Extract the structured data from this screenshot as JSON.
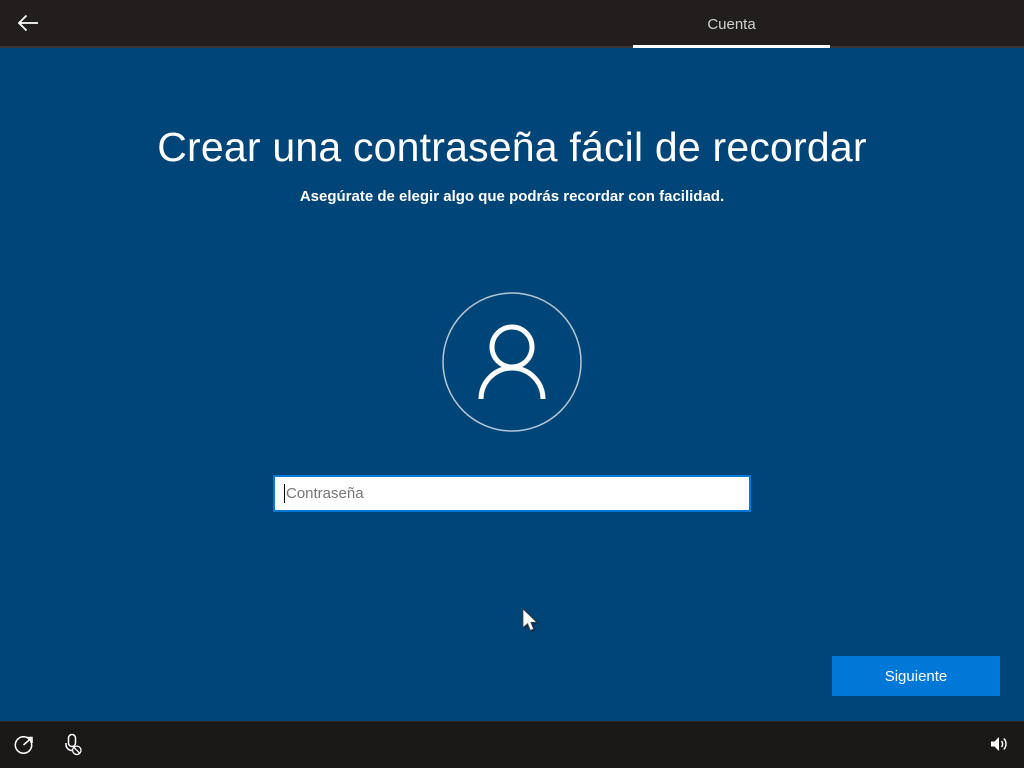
{
  "header": {
    "back_button": {
      "icon": "back-arrow-icon"
    },
    "active_tab": {
      "label": "Cuenta"
    }
  },
  "main": {
    "title": "Crear una contraseña fácil de recordar",
    "subtitle": "Asegúrate de elegir algo que podrás recordar con facilidad.",
    "avatar": {
      "icon": "user-avatar-icon"
    },
    "password_input": {
      "value": "",
      "placeholder": "Contraseña"
    },
    "next_button": {
      "label": "Siguiente"
    }
  },
  "footer": {
    "ease_of_access_button": {
      "icon": "ease-of-access-icon"
    },
    "microphone_button": {
      "icon": "microphone-muted-icon"
    },
    "volume_button": {
      "icon": "volume-icon"
    }
  },
  "cursor": {
    "icon": "arrow-cursor-icon"
  },
  "colors": {
    "background": "#004578",
    "accent": "#0078d7",
    "top_bar": "#211e1d",
    "bottom_bar": "#1b1918",
    "tab_underline": "#ffffff",
    "placeholder_text": "#767676"
  }
}
